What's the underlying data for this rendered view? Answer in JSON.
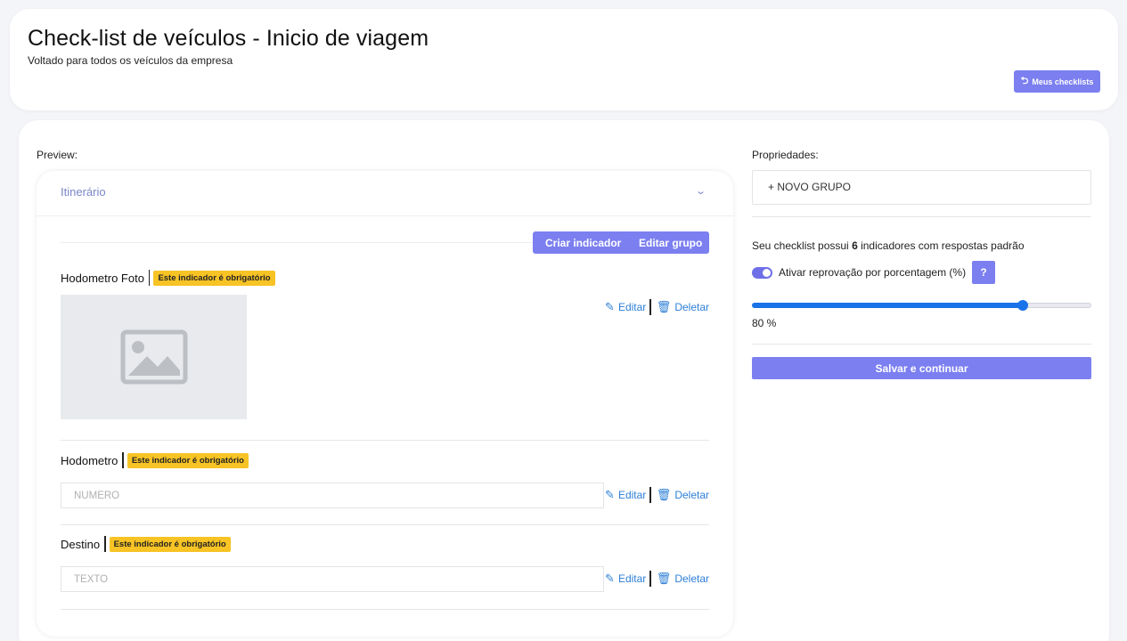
{
  "header": {
    "title": "Check-list de veículos - Inicio de viagem",
    "subtitle": "Voltado para todos os veículos da empresa",
    "my_checklists_label": "Meus checklists",
    "my_checklists_icon": "undo-icon"
  },
  "preview": {
    "label": "Preview:",
    "group_title": "Itinerário",
    "group_chevron_icon": "chevron-down-icon",
    "toolbar": {
      "create_indicator": "Criar indicador",
      "edit_group": "Editar grupo"
    },
    "indicators": [
      {
        "name": "Hodometro Foto",
        "badge": "Este indicador é obrigatório",
        "type": "photo",
        "edit_label": "Editar",
        "delete_label": "Deletar"
      },
      {
        "name": "Hodometro",
        "badge": "Este indicador é obrigatório",
        "type": "number",
        "placeholder": "NUMERO",
        "edit_label": "Editar",
        "delete_label": "Deletar"
      },
      {
        "name": "Destino",
        "badge": "Este indicador é obrigatório",
        "type": "text",
        "placeholder": "TEXTO",
        "edit_label": "Editar",
        "delete_label": "Deletar"
      }
    ]
  },
  "properties": {
    "label": "Propriedades:",
    "new_group_label": "+ NOVO GRUPO",
    "summary_prefix": "Seu checklist possui ",
    "summary_count": "6",
    "summary_suffix": " indicadores com respostas padrão",
    "toggle_label": "Ativar reprovação por porcentagem (%)",
    "toggle_on": true,
    "help_label": "?",
    "slider_value": 80,
    "slider_text": "80 %",
    "save_label": "Salvar e continuar"
  },
  "colors": {
    "accent": "#7b7ff0",
    "badge": "#f7c325",
    "link": "#2d7fd6",
    "slider": "#1a73e8"
  }
}
